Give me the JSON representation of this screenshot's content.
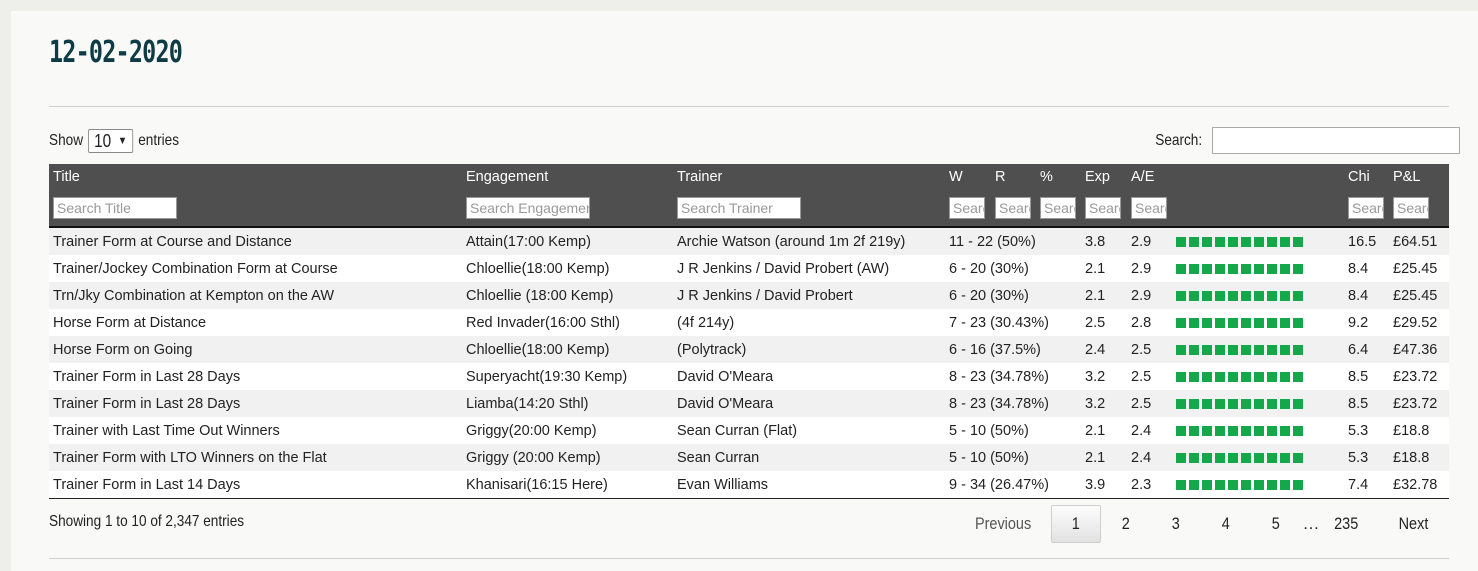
{
  "page": {
    "title": "12-02-2020"
  },
  "length_control": {
    "show_label": "Show",
    "value": "10",
    "entries_label": "entries"
  },
  "search": {
    "label": "Search:",
    "value": ""
  },
  "table": {
    "columns": [
      "Title",
      "Engagement",
      "Trainer",
      "W",
      "R",
      "%",
      "Exp",
      "A/E",
      "",
      "Chi",
      "P&L"
    ],
    "filters": [
      "Search Title",
      "Search Engagement",
      "Search Trainer",
      "Search",
      "Search",
      "Search",
      "Search",
      "Search",
      "",
      "Search",
      "Search"
    ],
    "rows": [
      {
        "title": "Trainer Form at Course and Distance",
        "engagement": "Attain(17:00 Kemp)",
        "trainer": "Archie Watson (around 1m 2f 219y)",
        "wr": "11 - 22 (50%)",
        "exp": "3.8",
        "ae": "2.9",
        "chi": "16.5",
        "pl": "£64.51"
      },
      {
        "title": "Trainer/Jockey Combination Form at Course",
        "engagement": "Chloellie(18:00 Kemp)",
        "trainer": "J R Jenkins / David Probert (AW)",
        "wr": "6 - 20 (30%)",
        "exp": "2.1",
        "ae": "2.9",
        "chi": "8.4",
        "pl": "£25.45"
      },
      {
        "title": "Trn/Jky Combination at Kempton on the AW",
        "engagement": "Chloellie (18:00 Kemp)",
        "trainer": "J R Jenkins / David Probert",
        "wr": "6 - 20 (30%)",
        "exp": "2.1",
        "ae": "2.9",
        "chi": "8.4",
        "pl": "£25.45"
      },
      {
        "title": "Horse Form at Distance",
        "engagement": "Red Invader(16:00 Sthl)",
        "trainer": "(4f 214y)",
        "wr": "7 - 23 (30.43%)",
        "exp": "2.5",
        "ae": "2.8",
        "chi": "9.2",
        "pl": "£29.52"
      },
      {
        "title": "Horse Form on Going",
        "engagement": "Chloellie(18:00 Kemp)",
        "trainer": "(Polytrack)",
        "wr": "6 - 16 (37.5%)",
        "exp": "2.4",
        "ae": "2.5",
        "chi": "6.4",
        "pl": "£47.36"
      },
      {
        "title": "Trainer Form in Last 28 Days",
        "engagement": "Superyacht(19:30 Kemp)",
        "trainer": "David O'Meara",
        "wr": "8 - 23 (34.78%)",
        "exp": "3.2",
        "ae": "2.5",
        "chi": "8.5",
        "pl": "£23.72"
      },
      {
        "title": "Trainer Form in Last 28 Days",
        "engagement": "Liamba(14:20 Sthl)",
        "trainer": "David O'Meara",
        "wr": "8 - 23 (34.78%)",
        "exp": "3.2",
        "ae": "2.5",
        "chi": "8.5",
        "pl": "£23.72"
      },
      {
        "title": "Trainer with Last Time Out Winners",
        "engagement": "Griggy(20:00 Kemp)",
        "trainer": "Sean Curran (Flat)",
        "wr": "5 - 10 (50%)",
        "exp": "2.1",
        "ae": "2.4",
        "chi": "5.3",
        "pl": "£18.8"
      },
      {
        "title": "Trainer Form with LTO Winners on the Flat",
        "engagement": "Griggy (20:00 Kemp)",
        "trainer": "Sean Curran",
        "wr": "5 - 10 (50%)",
        "exp": "2.1",
        "ae": "2.4",
        "chi": "5.3",
        "pl": "£18.8"
      },
      {
        "title": "Trainer Form in Last 14 Days",
        "engagement": "Khanisari(16:15 Here)",
        "trainer": "Evan Williams",
        "wr": "9 - 34 (26.47%)",
        "exp": "3.9",
        "ae": "2.3",
        "chi": "7.4",
        "pl": "£32.78"
      }
    ],
    "form_squares_per_row": 10,
    "form_color": "#14a84a",
    "header_bg": "#4f4f4f"
  },
  "info": {
    "text": "Showing 1 to 10 of 2,347 entries"
  },
  "pagination": {
    "previous": "Previous",
    "pages": [
      "1",
      "2",
      "3",
      "4",
      "5"
    ],
    "current": "1",
    "ellipsis": "…",
    "last": "235",
    "next": "Next"
  }
}
